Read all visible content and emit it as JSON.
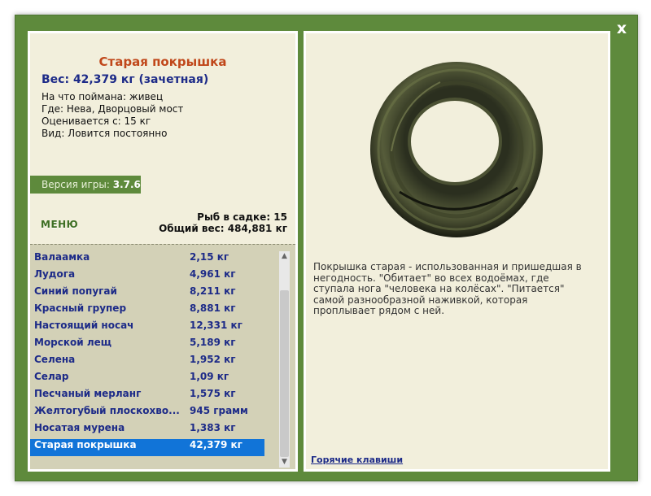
{
  "window": {
    "close_label": "x"
  },
  "catch": {
    "title": "Старая покрышка",
    "weight": "Вес: 42,379 кг (зачетная)",
    "info": [
      "На что поймана: живец",
      "Где: Нева, Дворцовый мост",
      "Оценивается с: 15 кг",
      "Вид: Ловится постоянно"
    ],
    "description": "Покрышка старая - использованная и пришедшая в негодность. \"Обитает\" во всех водоёмах, где ступала нога \"человека на колёсах\". \"Питается\" самой разнообразной наживкой, которая проплывает рядом с ней.",
    "image_icon": "old-tire"
  },
  "version": {
    "label": "Версия игры:",
    "value": "3.7.6"
  },
  "menu_label": "МЕНЮ",
  "stats": {
    "count_text": "Рыб в садке: 15",
    "total_text": "Общий вес: 484,881 кг"
  },
  "fish_list": [
    {
      "name": "Валаамка",
      "weight": "2,15 кг"
    },
    {
      "name": "Лудога",
      "weight": "4,961 кг"
    },
    {
      "name": "Синий попугай",
      "weight": "8,211 кг"
    },
    {
      "name": "Красный групер",
      "weight": "8,881 кг"
    },
    {
      "name": "Настоящий носач",
      "weight": "12,331 кг"
    },
    {
      "name": "Морской лещ",
      "weight": "5,189 кг"
    },
    {
      "name": "Селена",
      "weight": "1,952 кг"
    },
    {
      "name": "Селар",
      "weight": "1,09 кг"
    },
    {
      "name": "Песчаный мерланг",
      "weight": "1,575 кг"
    },
    {
      "name": "Желтогубый плоскохво...",
      "weight": "945 грамм"
    },
    {
      "name": "Носатая мурена",
      "weight": "1,383 кг"
    },
    {
      "name": "Старая покрышка",
      "weight": "42,379 кг",
      "selected": true
    }
  ],
  "hotkeys_label": "Горячие клавиши",
  "colors": {
    "frame": "#5e8a3c",
    "panel": "#f2efdc",
    "title": "#c0471a",
    "accent": "#1d2b88",
    "selection": "#1174d8"
  }
}
